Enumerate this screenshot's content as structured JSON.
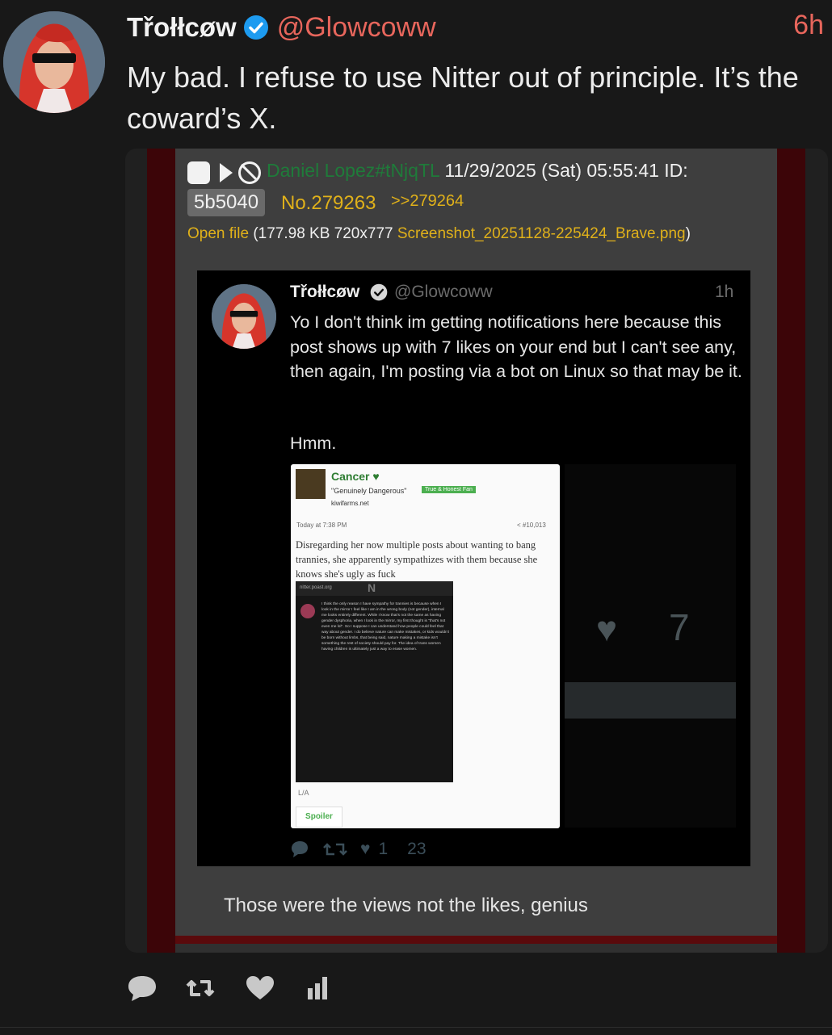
{
  "post": {
    "display_name": "Třołłcøw",
    "handle": "@Glowcoww",
    "time": "6h",
    "body": "My bad. I refuse to use Nitter out of principle. It’s the coward’s X."
  },
  "embed": {
    "poster_name": "Daniel Lopez#tNjqTL",
    "datetime": "11/29/2025 (Sat) 05:55:41 ID:",
    "id": "5b5040",
    "post_number": "No.279263",
    "quote_link": ">>279264",
    "open_file": "Open file",
    "file_meta": "(177.98 KB 720x777",
    "file_name": "Screenshot_20251128-225424_Brave.png",
    "file_close": ")",
    "caption": "Those were the views not the likes, genius"
  },
  "inner_post": {
    "display_name": "Třołłcøw",
    "handle": "@Glowcoww",
    "time": "1h",
    "body": "Yo I don't think im getting notifications here because this post shows up with 7 likes on your end but I can't see any, then again, I'm posting via a bot on Linux so that may be it.",
    "body2": "Hmm.",
    "likes_shown": "7",
    "reply_icon": "reply-icon",
    "repost_icon": "repost-icon",
    "like_count": "1",
    "view_count": "23"
  },
  "kiwi_card": {
    "name": "Cancer",
    "title": "\"Genuinely Dangerous\"",
    "badge": "True & Honest Fan",
    "site": "kiwifarms.net",
    "date": "Today at 7:38 PM",
    "post_number": "#10,013",
    "text": "Disregarding her now multiple posts about wanting to bang trannies, she apparently sympathizes with them because she knows she's ugly as fuck",
    "embedded_site": "nitter.poast.org",
    "embedded_text": "I think the only reason I have sympathy for trannies is because when I look in the mirror I feel like I am in the wrong body (not gender), internal me looks entirely different. While I know that's not the same as having gender dysphoria, when I look in the mirror, my first thought is \"that's not even me lol\". So I suppose I can understand how people could feel that way about gender. I do believe nature can make mistakes, or kids wouldn't be born without limbs, that being said, nature making a mistake isn't something the rest of society should pay for. The idea of trans women having children is ultimately just a way to erase women.",
    "la": "L/A",
    "spoiler": "Spoiler"
  },
  "actions": [
    "reply-icon",
    "repost-icon",
    "like-icon",
    "stats-icon"
  ],
  "colors": {
    "accent": "#e8665c",
    "verified": "#1d9bf0",
    "background": "#181818",
    "chan_yellow": "#e0b11a",
    "chan_green": "#1f7b3a"
  }
}
